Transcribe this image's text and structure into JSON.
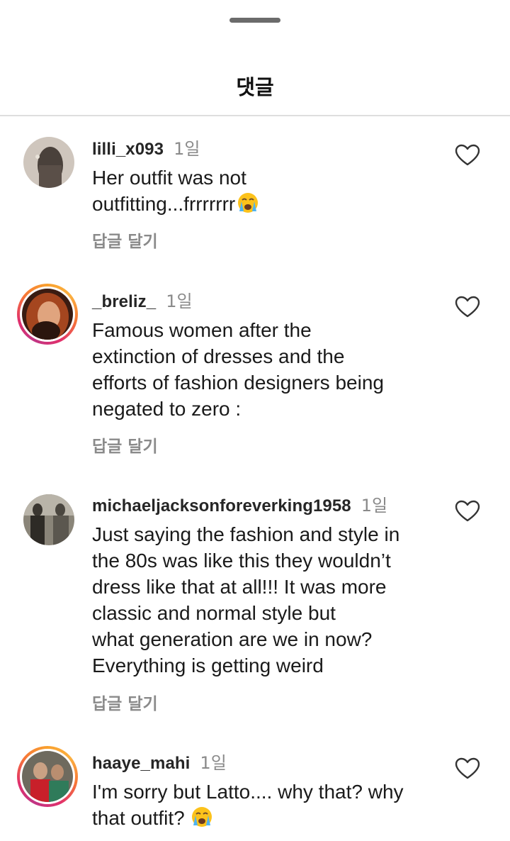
{
  "sheet": {
    "title": "댓글"
  },
  "comments": [
    {
      "username": "lilli_x093",
      "time": "1일",
      "text": "Her outfit was not\noutfitting...frrrrrrr",
      "emoji": "loudly-crying-face",
      "reply_label": "답글 달기",
      "has_story_ring": false
    },
    {
      "username": "_breliz_",
      "time": "1일",
      "text": "Famous women after the\nextinction of dresses and the\nefforts of fashion designers being\nnegated to zero :",
      "emoji": "",
      "reply_label": "답글 달기",
      "has_story_ring": true
    },
    {
      "username": "michaeljacksonforeverking1958",
      "time": "1일",
      "text": "Just saying the fashion and style in\nthe 80s was like this they wouldn’t\ndress like that at all!!! It was more\nclassic and normal style but\nwhat generation are we in now?\nEverything is getting weird",
      "emoji": "",
      "reply_label": "답글 달기",
      "has_story_ring": false
    },
    {
      "username": "haaye_mahi",
      "time": "1일",
      "text": "I'm sorry but Latto.... why that? why\nthat outfit?",
      "emoji": "loudly-crying-face",
      "reply_label": "",
      "has_story_ring": true
    }
  ],
  "icons": {
    "like": "heart-outline-icon",
    "emoji": "loudly-crying-face"
  },
  "colors": {
    "username": "#262626",
    "secondary": "#8a8a8a",
    "ring_start": "#f9a12e",
    "ring_end": "#c13584"
  }
}
